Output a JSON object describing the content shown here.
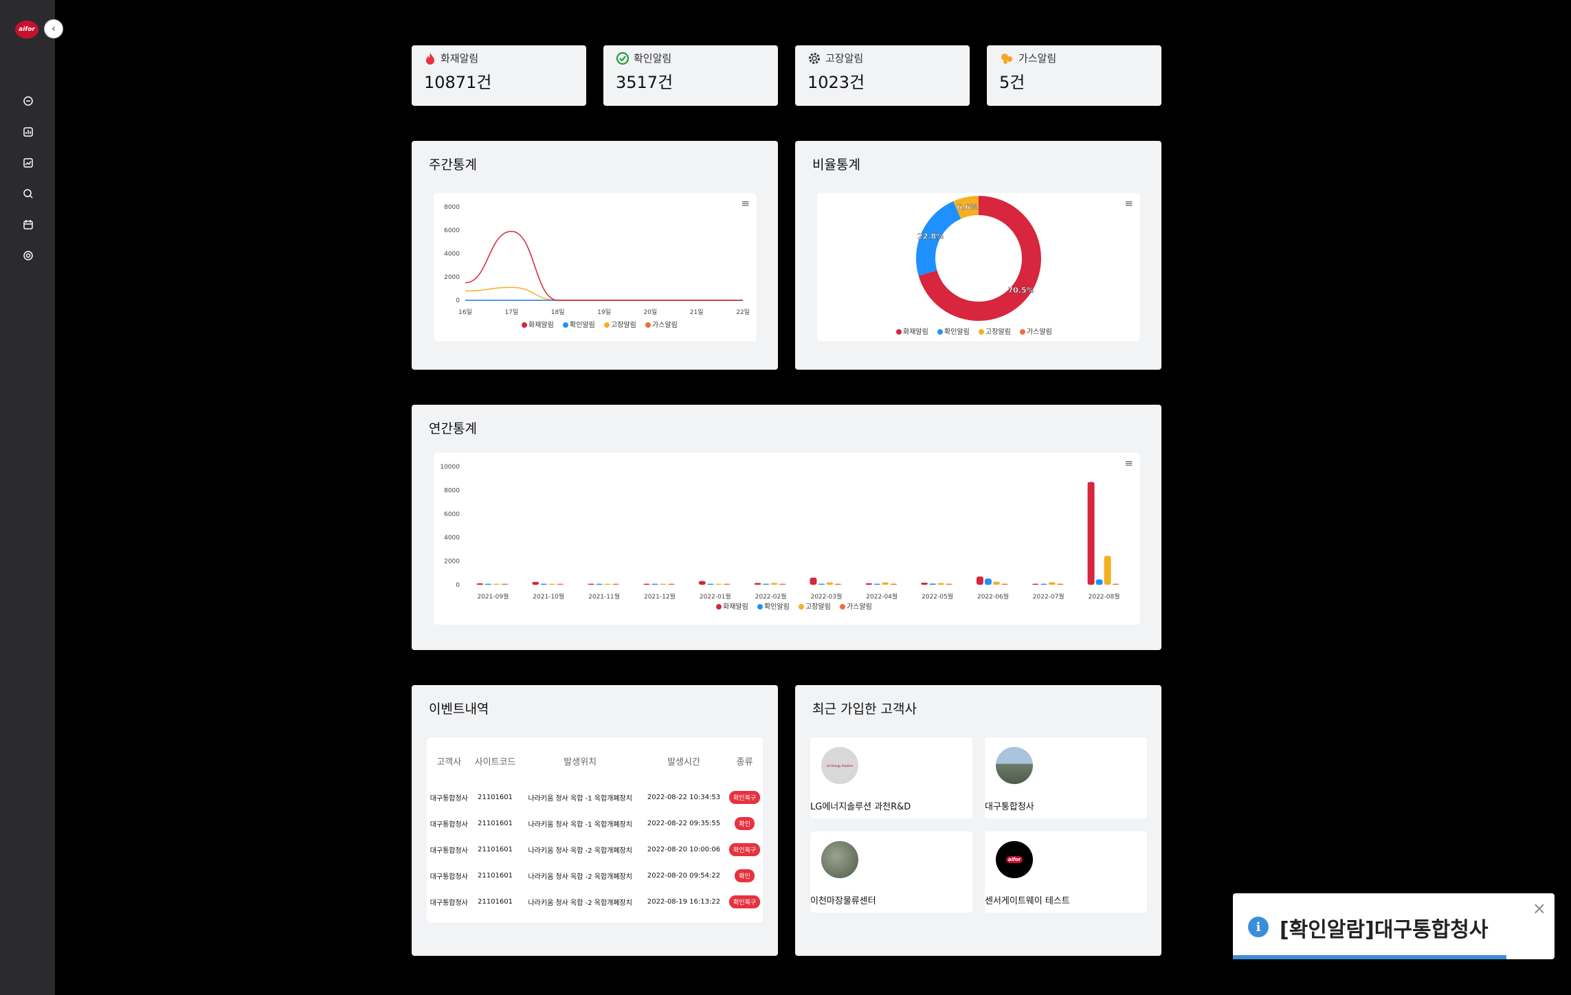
{
  "sidebar": {
    "logo_text": "aifor",
    "collapse_icon": "chevron-left-icon",
    "items": [
      {
        "icon": "dashboard-icon"
      },
      {
        "icon": "bar-chart-icon"
      },
      {
        "icon": "line-chart-icon"
      },
      {
        "icon": "search-icon"
      },
      {
        "icon": "calendar-icon"
      },
      {
        "icon": "settings-icon"
      }
    ]
  },
  "stats": [
    {
      "label": "화재알림",
      "value": "10871건",
      "icon": "fire-icon",
      "color": "#e8323f"
    },
    {
      "label": "확인알림",
      "value": "3517건",
      "icon": "check-circle-icon",
      "color": "#1f9d3a"
    },
    {
      "label": "고장알림",
      "value": "1023건",
      "icon": "gear-alert-icon",
      "color": "#333333"
    },
    {
      "label": "가스알림",
      "value": "5건",
      "icon": "gas-icon",
      "color": "#f5a623"
    }
  ],
  "weekly": {
    "title": "주간통계",
    "chart_data": {
      "type": "line",
      "x": [
        "16일",
        "17일",
        "18일",
        "19일",
        "20일",
        "21일",
        "22일"
      ],
      "ylim": [
        0,
        8000
      ],
      "yticks": [
        0,
        2000,
        4000,
        6000,
        8000
      ],
      "series": [
        {
          "name": "화재알림",
          "color": "#d7263d",
          "values": [
            1500,
            5900,
            0,
            0,
            0,
            0,
            0
          ]
        },
        {
          "name": "확인알림",
          "color": "#1e90ff",
          "values": [
            0,
            0,
            0,
            0,
            0,
            0,
            0
          ]
        },
        {
          "name": "고장알림",
          "color": "#f5b021",
          "values": [
            800,
            1100,
            0,
            0,
            0,
            0,
            0
          ]
        },
        {
          "name": "가스알림",
          "color": "#f26b3a",
          "values": [
            0,
            0,
            0,
            0,
            0,
            0,
            0
          ]
        }
      ]
    }
  },
  "ratio": {
    "title": "비율통계",
    "chart_data": {
      "type": "pie",
      "labels": [
        "화재알림",
        "확인알림",
        "고장알림",
        "가스알림"
      ],
      "values": [
        70.5,
        22.8,
        6.6,
        0.1
      ],
      "value_labels": [
        "70.5%",
        "22.8%",
        "6.6%",
        ""
      ],
      "colors": [
        "#d7263d",
        "#1e90ff",
        "#f5b021",
        "#f26b3a"
      ]
    }
  },
  "yearly": {
    "title": "연간통계",
    "chart_data": {
      "type": "bar",
      "categories": [
        "2021-09월",
        "2021-10월",
        "2021-11월",
        "2021-12월",
        "2022-01월",
        "2022-02월",
        "2022-03월",
        "2022-04월",
        "2022-05월",
        "2022-06월",
        "2022-07월",
        "2022-08월"
      ],
      "ylim": [
        0,
        10000
      ],
      "yticks": [
        0,
        2000,
        4000,
        6000,
        8000,
        10000
      ],
      "series": [
        {
          "name": "화재알림",
          "color": "#d7263d",
          "values": [
            120,
            250,
            60,
            60,
            320,
            150,
            600,
            130,
            180,
            700,
            70,
            8700
          ]
        },
        {
          "name": "확인알림",
          "color": "#1e90ff",
          "values": [
            60,
            50,
            30,
            30,
            60,
            60,
            90,
            60,
            100,
            520,
            50,
            450
          ]
        },
        {
          "name": "고장알림",
          "color": "#f5b021",
          "values": [
            80,
            60,
            40,
            40,
            80,
            150,
            200,
            200,
            150,
            260,
            220,
            2450
          ]
        },
        {
          "name": "가스알림",
          "color": "#f26b3a",
          "values": [
            10,
            10,
            10,
            10,
            10,
            10,
            10,
            10,
            10,
            10,
            10,
            10
          ]
        }
      ]
    }
  },
  "events": {
    "title": "이벤트내역",
    "columns": [
      "고객사",
      "사이트코드",
      "발생위치",
      "발생시간",
      "종류"
    ],
    "rows": [
      {
        "customer": "대구통합청사",
        "code": "21101601",
        "location": "나라키움 청사 옥합 -1 옥합개폐장치",
        "time": "2022-08-22 10:34:53",
        "type": "확인복구"
      },
      {
        "customer": "대구통합청사",
        "code": "21101601",
        "location": "나라키움 청사 옥합 -1 옥합개폐장치",
        "time": "2022-08-22 09:35:55",
        "type": "확인"
      },
      {
        "customer": "대구통합청사",
        "code": "21101601",
        "location": "나라키움 청사 옥합 -2 옥합개폐장치",
        "time": "2022-08-20 10:00:06",
        "type": "확인복구"
      },
      {
        "customer": "대구통합청사",
        "code": "21101601",
        "location": "나라키움 청사 옥합 -2 옥합개폐장치",
        "time": "2022-08-20 09:54:22",
        "type": "확인"
      },
      {
        "customer": "대구통합청사",
        "code": "21101601",
        "location": "나라키움 청사 옥합 -2 옥합개폐장치",
        "time": "2022-08-19 16:13:22",
        "type": "확인복구"
      }
    ]
  },
  "customers": {
    "title": "최근 가입한 고객사",
    "items": [
      {
        "name": "LG에너지솔루션 과천R&D",
        "avatar_text": "LG Energy Solution"
      },
      {
        "name": "대구통합청사",
        "avatar_text": ""
      },
      {
        "name": "이천마장물류센터",
        "avatar_text": ""
      },
      {
        "name": "센서게이트웨이 테스트",
        "avatar_text": "aifor"
      }
    ]
  },
  "toast": {
    "message": "[확인알람]대구통합청사",
    "progress": 0.85
  }
}
